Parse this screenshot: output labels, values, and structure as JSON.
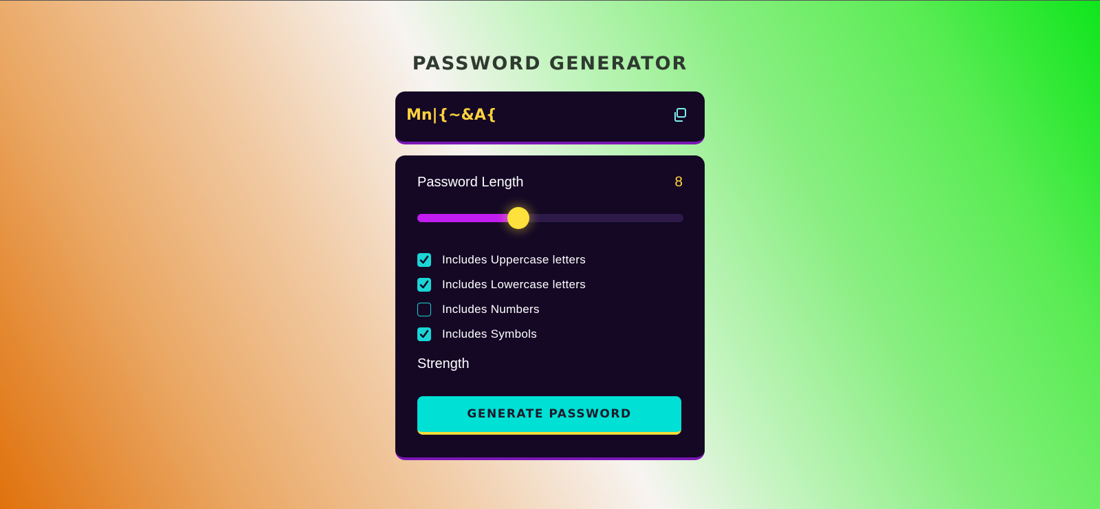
{
  "app": {
    "title": "PASSWORD GENERATOR"
  },
  "output": {
    "password": "Mn|{~&A{",
    "copy_icon": "copy-icon"
  },
  "settings": {
    "length_label": "Password Length",
    "length_value": "8",
    "slider": {
      "min": 4,
      "max": 20,
      "value": 8,
      "fill_fraction": 0.38
    },
    "options": [
      {
        "label": "Includes Uppercase letters",
        "checked": true
      },
      {
        "label": "Includes Lowercase letters",
        "checked": true
      },
      {
        "label": "Includes Numbers",
        "checked": false
      },
      {
        "label": "Includes Symbols",
        "checked": true
      }
    ],
    "strength_label": "Strength",
    "generate_label": "GENERATE PASSWORD"
  },
  "colors": {
    "accent_yellow": "#ffd23e",
    "accent_cyan": "#1ad6d6",
    "accent_purple": "#c21cf1",
    "card_bg": "#140825"
  }
}
